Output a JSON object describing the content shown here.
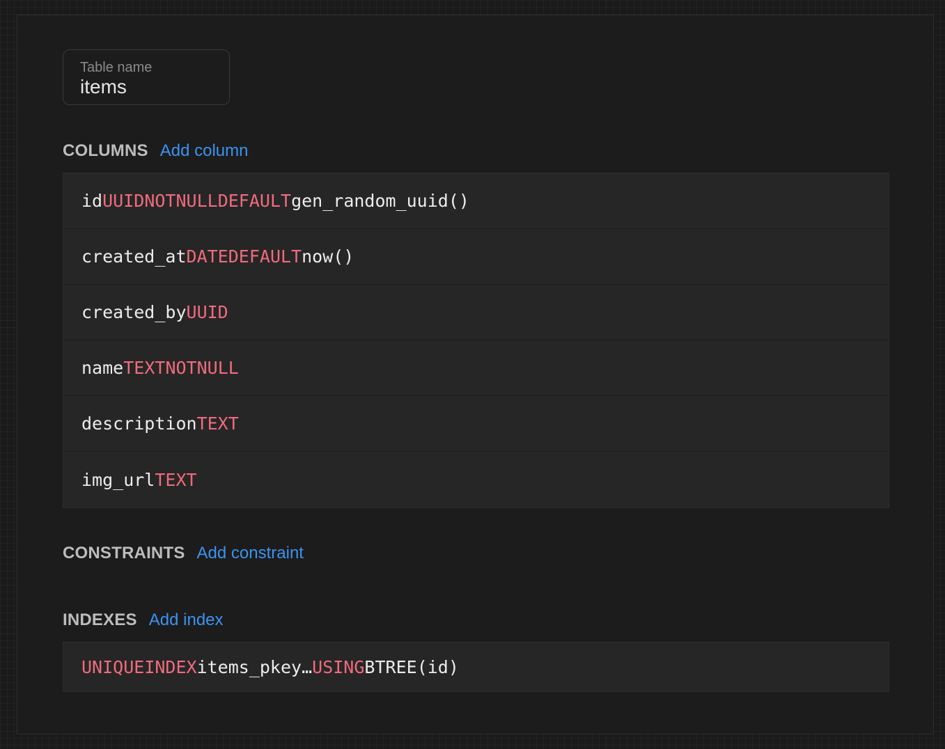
{
  "table_name": {
    "label": "Table name",
    "value": "items"
  },
  "columns": {
    "title": "COLUMNS",
    "add_label": "Add column",
    "rows": [
      {
        "name": "id",
        "type": "UUID",
        "modifiers": [
          "NOT",
          "NULL",
          "DEFAULT"
        ],
        "default": "gen_random_uuid()"
      },
      {
        "name": "created_at",
        "type": "DATE",
        "modifiers": [
          "DEFAULT"
        ],
        "default": "now()"
      },
      {
        "name": "created_by",
        "type": "UUID",
        "modifiers": [],
        "default": ""
      },
      {
        "name": "name",
        "type": "TEXT",
        "modifiers": [
          "NOT",
          "NULL"
        ],
        "default": ""
      },
      {
        "name": "description",
        "type": "TEXT",
        "modifiers": [],
        "default": ""
      },
      {
        "name": "img_url",
        "type": "TEXT",
        "modifiers": [],
        "default": ""
      }
    ]
  },
  "constraints": {
    "title": "CONSTRAINTS",
    "add_label": "Add constraint"
  },
  "indexes": {
    "title": "INDEXES",
    "add_label": "Add index",
    "rows": [
      {
        "tokens": [
          {
            "text": "UNIQUE",
            "kw": true
          },
          {
            "text": "INDEX",
            "kw": true
          },
          {
            "text": "items_pkey",
            "kw": false
          },
          {
            "text": "…",
            "kw": false
          },
          {
            "text": "USING",
            "kw": true
          },
          {
            "text": "BTREE",
            "kw": false
          },
          {
            "text": "(id)",
            "kw": false
          }
        ]
      }
    ]
  },
  "colors": {
    "keyword": "#f06b7e",
    "link": "#3b93f0",
    "text": "#ececec",
    "background": "#1c1c1c"
  }
}
